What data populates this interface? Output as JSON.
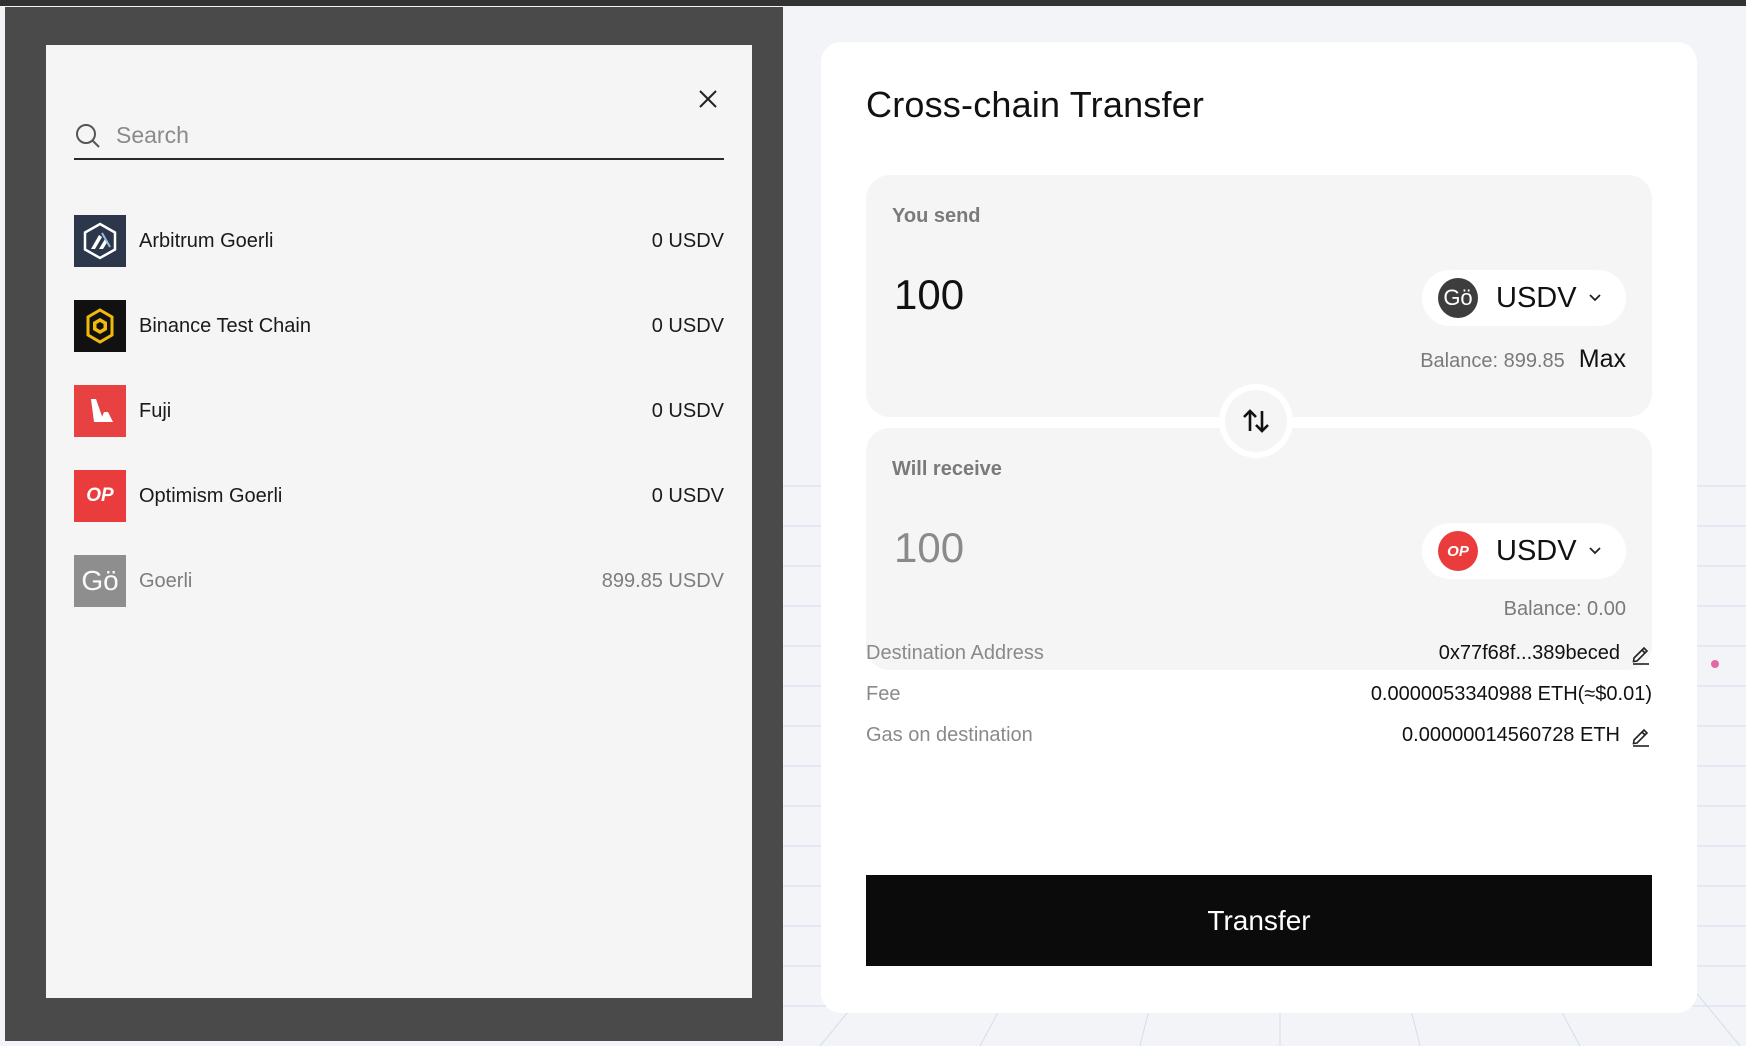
{
  "modal": {
    "search": {
      "placeholder": "Search",
      "value": ""
    },
    "chains": [
      {
        "name": "Arbitrum Goerli",
        "balance": "0 USDV",
        "icon": "arbitrum-logo"
      },
      {
        "name": "Binance Test Chain",
        "balance": "0 USDV",
        "icon": "bnb-logo"
      },
      {
        "name": "Fuji",
        "balance": "0 USDV",
        "icon": "avalanche-logo"
      },
      {
        "name": "Optimism Goerli",
        "balance": "0 USDV",
        "icon": "optimism-logo",
        "logo_text": "OP"
      },
      {
        "name": "Goerli",
        "balance": "899.85 USDV",
        "icon": "goerli-logo",
        "logo_text": "Gö",
        "selected": true
      }
    ]
  },
  "transfer": {
    "title": "Cross-chain Transfer",
    "send": {
      "label": "You send",
      "amount": "100",
      "token": "USDV",
      "token_icon_text": "Gö",
      "balance": "Balance: 899.85",
      "max_label": "Max"
    },
    "receive": {
      "label": "Will receive",
      "amount": "100",
      "token": "USDV",
      "token_icon_text": "OP",
      "balance": "Balance: 0.00"
    },
    "info": {
      "destination_label": "Destination Address",
      "destination_value": "0x77f68f...389beced",
      "fee_label": "Fee",
      "fee_value": "0.0000053340988 ETH(≈$0.01)",
      "gas_label": "Gas on destination",
      "gas_value": "0.00000014560728 ETH"
    },
    "button_label": "Transfer"
  },
  "colors": {
    "overlay": "#4a4a4a",
    "modal": "#f5f5f5",
    "primary_button": "#0b0b0b",
    "optimism_red": "#ea3c3c",
    "avalanche_red": "#e84142",
    "arbitrum_navy": "#2d374b",
    "bnb_yellow": "#f0b90b"
  }
}
